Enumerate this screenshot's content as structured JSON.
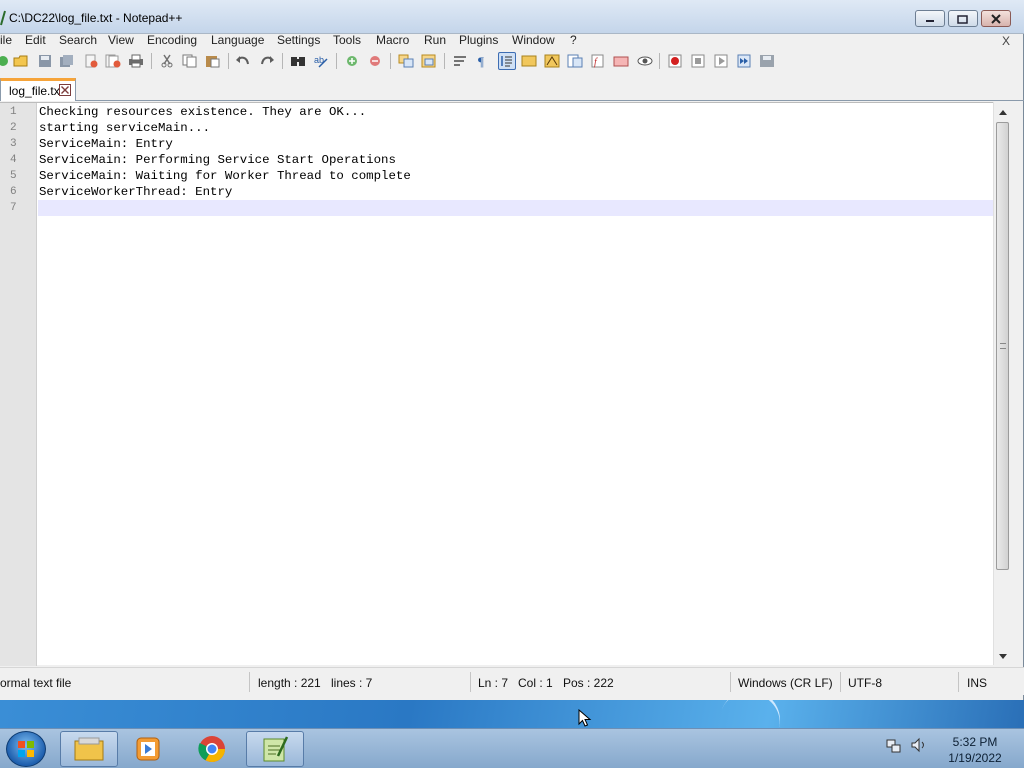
{
  "window": {
    "title": "C:\\DC22\\log_file.txt - Notepad++"
  },
  "menu": {
    "items": [
      "ile",
      "Edit",
      "Search",
      "View",
      "Encoding",
      "Language",
      "Settings",
      "Tools",
      "Macro",
      "Run",
      "Plugins",
      "Window",
      "?"
    ],
    "close": "X"
  },
  "toolbar": {
    "icons": [
      "new-file-icon",
      "open-file-icon",
      "save-icon",
      "save-all-icon",
      "close-icon",
      "close-all-icon",
      "print-icon",
      "cut-icon",
      "copy-icon",
      "paste-icon",
      "undo-icon",
      "redo-icon",
      "find-icon",
      "replace-icon",
      "zoom-in-icon",
      "zoom-out-icon",
      "sync-vertical-icon",
      "sync-horizontal-icon",
      "word-wrap-icon",
      "show-all-characters-icon",
      "indent-guide-icon",
      "user-language-icon",
      "document-map-icon",
      "function-list-icon",
      "folder-workspace-icon",
      "clear-icon",
      "monitoring-icon",
      "record-macro-icon",
      "stop-macro-icon",
      "play-macro-icon",
      "run-macro-multiple-icon",
      "save-macro-icon"
    ]
  },
  "tab": {
    "label": "log_file.txt"
  },
  "editor": {
    "lines": [
      {
        "n": "1",
        "text": "Checking resources existence. They are OK..."
      },
      {
        "n": "2",
        "text": "starting serviceMain..."
      },
      {
        "n": "3",
        "text": "ServiceMain: Entry"
      },
      {
        "n": "4",
        "text": "ServiceMain: Performing Service Start Operations"
      },
      {
        "n": "5",
        "text": "ServiceMain: Waiting for Worker Thread to complete"
      },
      {
        "n": "6",
        "text": "ServiceWorkerThread: Entry"
      },
      {
        "n": "7",
        "text": ""
      }
    ],
    "current_line": 7
  },
  "status": {
    "file_type": "ormal text file",
    "length": "length : 221",
    "lines": "lines : 7",
    "ln": "Ln : 7",
    "col": "Col : 1",
    "pos": "Pos : 222",
    "eol": "Windows (CR LF)",
    "encoding": "UTF-8",
    "mode": "INS"
  },
  "taskbar": {
    "time": "5:32 PM",
    "date": "1/19/2022",
    "apps": [
      "file-explorer-icon",
      "media-player-icon",
      "chrome-icon",
      "notepadpp-icon"
    ]
  },
  "colors": {
    "tab_accent": "#f6a43a",
    "current_line": "#e8e8ff",
    "gutter": "#e4e4e4",
    "line_number": "#808080"
  }
}
